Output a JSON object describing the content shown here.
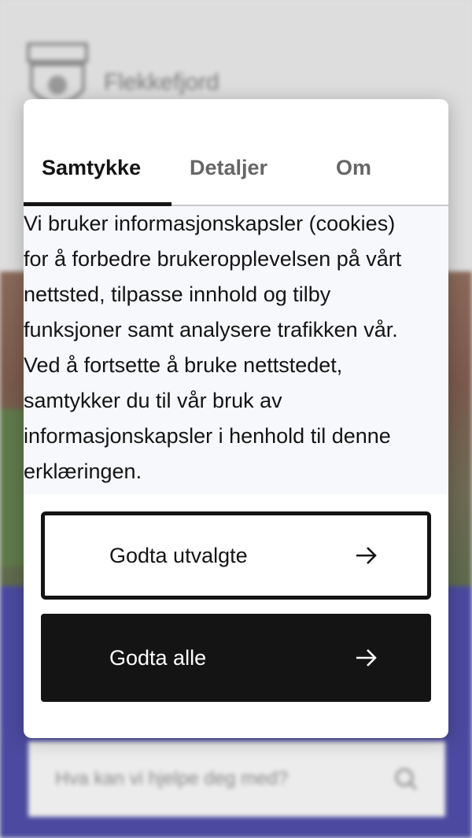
{
  "background": {
    "site_name": "Flekkefjord",
    "search_placeholder": "Hva kan vi hjelpe deg med?"
  },
  "dialog": {
    "tabs": [
      {
        "label": "Samtykke",
        "active": true
      },
      {
        "label": "Detaljer",
        "active": false
      },
      {
        "label": "Om",
        "active": false
      }
    ],
    "body_lines": [
      "Vi bruker informasjonskapsler (cookies)",
      "for å forbedre brukeropplevelsen på vårt",
      "nettsted, tilpasse innhold og tilby",
      "funksjoner samt analysere trafikken vår.",
      "Ved å fortsette å bruke nettstedet,",
      "samtykker du til vår bruk av",
      "informasjonskapsler i henhold til denne",
      "erklæringen."
    ],
    "buttons": {
      "accept_selected": "Godta utvalgte",
      "accept_all": "Godta alle"
    }
  },
  "colors": {
    "primary": "#141414",
    "dialog_bg": "#ffffff",
    "background_accent": "#4b4aa0"
  },
  "icons": [
    "arrow-right-icon",
    "search-icon",
    "coat-of-arms-logo"
  ]
}
